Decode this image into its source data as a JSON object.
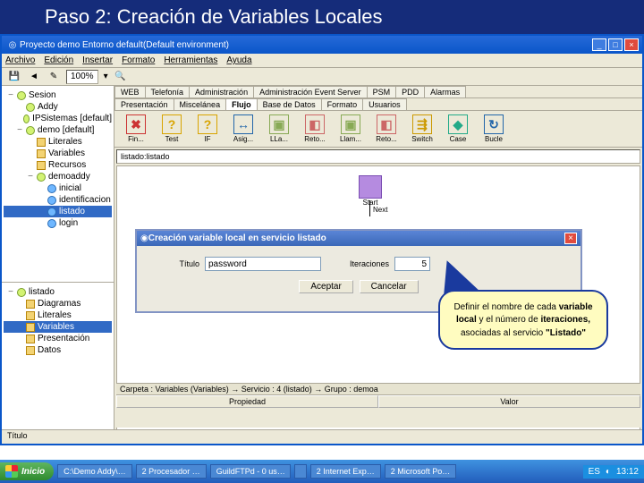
{
  "slide": {
    "title": "Paso 2: Creación de Variables Locales"
  },
  "window": {
    "title": "Proyecto demo Entorno default(Default environment)",
    "menu": [
      "Archivo",
      "Edición",
      "Insertar",
      "Formato",
      "Herramientas",
      "Ayuda"
    ],
    "zoom": "100%"
  },
  "tree_top": {
    "header": "",
    "root": "Sesion",
    "items": [
      {
        "label": "Addy",
        "icon": "gear",
        "ind": 1
      },
      {
        "label": "IPSistemas [default]",
        "icon": "gear",
        "ind": 1
      },
      {
        "label": "demo [default]",
        "icon": "gear",
        "ind": 1,
        "open": true
      },
      {
        "label": "Literales",
        "icon": "folder",
        "ind": 2
      },
      {
        "label": "Variables",
        "icon": "folder",
        "ind": 2
      },
      {
        "label": "Recursos",
        "icon": "folder",
        "ind": 2
      },
      {
        "label": "demoaddy",
        "icon": "gear",
        "ind": 2,
        "open": true
      },
      {
        "label": "inicial",
        "icon": "dot",
        "ind": 3
      },
      {
        "label": "identificacion",
        "icon": "dot",
        "ind": 3
      },
      {
        "label": "listado",
        "icon": "dot",
        "ind": 3,
        "sel": true
      },
      {
        "label": "login",
        "icon": "dot",
        "ind": 3
      }
    ]
  },
  "tree_bottom": {
    "root": "listado",
    "items": [
      {
        "label": "Diagramas",
        "icon": "folder",
        "ind": 1
      },
      {
        "label": "Literales",
        "icon": "folder",
        "ind": 1
      },
      {
        "label": "Variables",
        "icon": "folder",
        "ind": 1,
        "sel": true
      },
      {
        "label": "Presentación",
        "icon": "folder",
        "ind": 1
      },
      {
        "label": "Datos",
        "icon": "folder",
        "ind": 1
      }
    ]
  },
  "tabs_row1": [
    "WEB",
    "Telefonía",
    "Administración",
    "Administración Event Server",
    "PSM",
    "PDD",
    "Alarmas"
  ],
  "tabs_row2": [
    "Presentación",
    "Miscelánea",
    "Flujo",
    "Base de Datos",
    "Formato",
    "Usuarios"
  ],
  "active_tab": "Flujo",
  "icon_row": [
    {
      "lbl": "Fin...",
      "glyph": "✖",
      "color": "#c33"
    },
    {
      "lbl": "Test",
      "glyph": "?",
      "color": "#d8a400"
    },
    {
      "lbl": "IF",
      "glyph": "?",
      "color": "#d8a400"
    },
    {
      "lbl": "Asig...",
      "glyph": "↔",
      "color": "#26a"
    },
    {
      "lbl": "LLa...",
      "glyph": "▣",
      "color": "#8a5"
    },
    {
      "lbl": "Reto...",
      "glyph": "◧",
      "color": "#c66"
    },
    {
      "lbl": "Llam...",
      "glyph": "▣",
      "color": "#8a5"
    },
    {
      "lbl": "Reto...",
      "glyph": "◧",
      "color": "#c66"
    },
    {
      "lbl": "Switch",
      "glyph": "⇶",
      "color": "#c90"
    },
    {
      "lbl": "Case",
      "glyph": "◆",
      "color": "#2a8"
    },
    {
      "lbl": "Bucle",
      "glyph": "↻",
      "color": "#26a"
    }
  ],
  "breadcrumb": "listado:listado",
  "canvas": {
    "start": "Start",
    "next": "Next"
  },
  "dialog": {
    "title": "Creación variable local en servicio listado",
    "titulo_label": "Título",
    "titulo_value": "password",
    "iter_label": "Iteraciones",
    "iter_value": "5",
    "accept": "Aceptar",
    "cancel": "Cancelar"
  },
  "callout": {
    "l1": "Definir el nombre de cada ",
    "b1": "variable local",
    "l2": " y el número de ",
    "b2": "iteraciones,",
    "l3": " asociadas al servicio ",
    "b3": "\"Listado\""
  },
  "bottom": {
    "crumb": "Carpeta : Variables (Variables)  →  Servicio : 4 (listado)  →  Grupo : demoa",
    "col1": "Propiedad",
    "col2": "Valor"
  },
  "status": "Título",
  "taskbar": {
    "start": "Inicio",
    "items": [
      "C:\\Demo Addy\\…",
      "2  Procesador …",
      "GuildFTPd - 0 us…",
      "",
      "2 Internet Exp…",
      "2 Microsoft Po…"
    ],
    "tray_lang": "ES",
    "clock": "13:12"
  }
}
